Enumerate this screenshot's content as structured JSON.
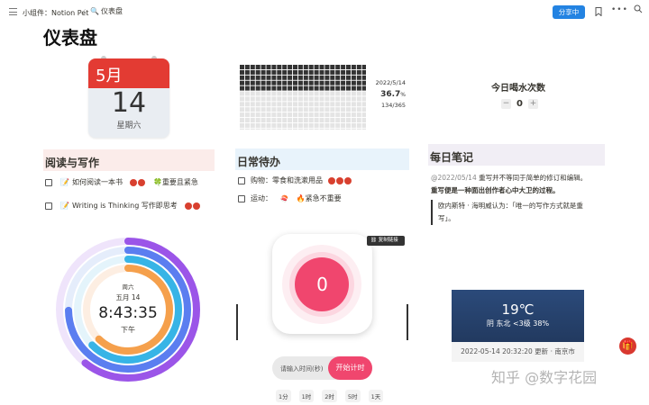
{
  "topbar": {
    "breadcrumb_parent": "小组件：Notion Pet",
    "breadcrumb_sep": "/",
    "page_icon": "🔍",
    "breadcrumb_current": "仪表盘",
    "share_label": "分享中",
    "bookmark_icon": "bookmark-icon",
    "more_icon": "more-icon"
  },
  "page": {
    "title": "仪表盘"
  },
  "calendar": {
    "month": "5月",
    "day": "14",
    "weekday": "星期六"
  },
  "year_progress": {
    "date": "2022/5/14",
    "percent": "36.7",
    "percent_unit": "%",
    "count": "134/365",
    "progress_fraction": 0.367
  },
  "water": {
    "title": "今日喝水次数",
    "count": "0",
    "minus": "−",
    "plus": "+"
  },
  "sections": {
    "reading": "阅读与写作",
    "daily": "日常待办",
    "notes": "每日笔记"
  },
  "reading_todos": [
    {
      "icon": "📝",
      "text": "如何阅读一本书",
      "tomatoes": "2",
      "tag": "🍀重要且紧急"
    },
    {
      "icon": "📝",
      "text": "Writing is Thinking 写作即思考",
      "tomatoes": "2",
      "tag": ""
    }
  ],
  "daily_todos": [
    {
      "text": "购物：零食和洗漱用品",
      "tomatoes": "3",
      "tag": ""
    },
    {
      "text": "运动：",
      "tomatoes": "0",
      "tag": "🔥紧急不重要"
    }
  ],
  "notes": {
    "line1_date": "@2022/05/14",
    "line1_text": "重写并不等同于简单的修订和编辑。",
    "line2": "重写便是一种面出创作者心中大卫的过程。",
    "quote": "欧内斯特 · 海明威认为：「唯一的写作方式就是重写」。"
  },
  "clock": {
    "weekday": "周六",
    "date": "五月 14",
    "time": "8:43:35",
    "ampm": "下午"
  },
  "timer": {
    "value": "0",
    "copy_label": "复制链接",
    "input_placeholder": "请输入时间(秒)",
    "start_label": "开始计时",
    "presets": [
      "1分",
      "1时",
      "2时",
      "5时",
      "1天"
    ]
  },
  "weather": {
    "temp": "19℃",
    "desc": "阴 东北 <3级 38%",
    "updated": "2022-05-14 20:32:20 更新 · 南京市"
  },
  "watermark": "知乎 @数字花园",
  "colors": {
    "accent": "#2383e2",
    "tomato": "#d8402f",
    "timer_pink": "#f0466e"
  }
}
